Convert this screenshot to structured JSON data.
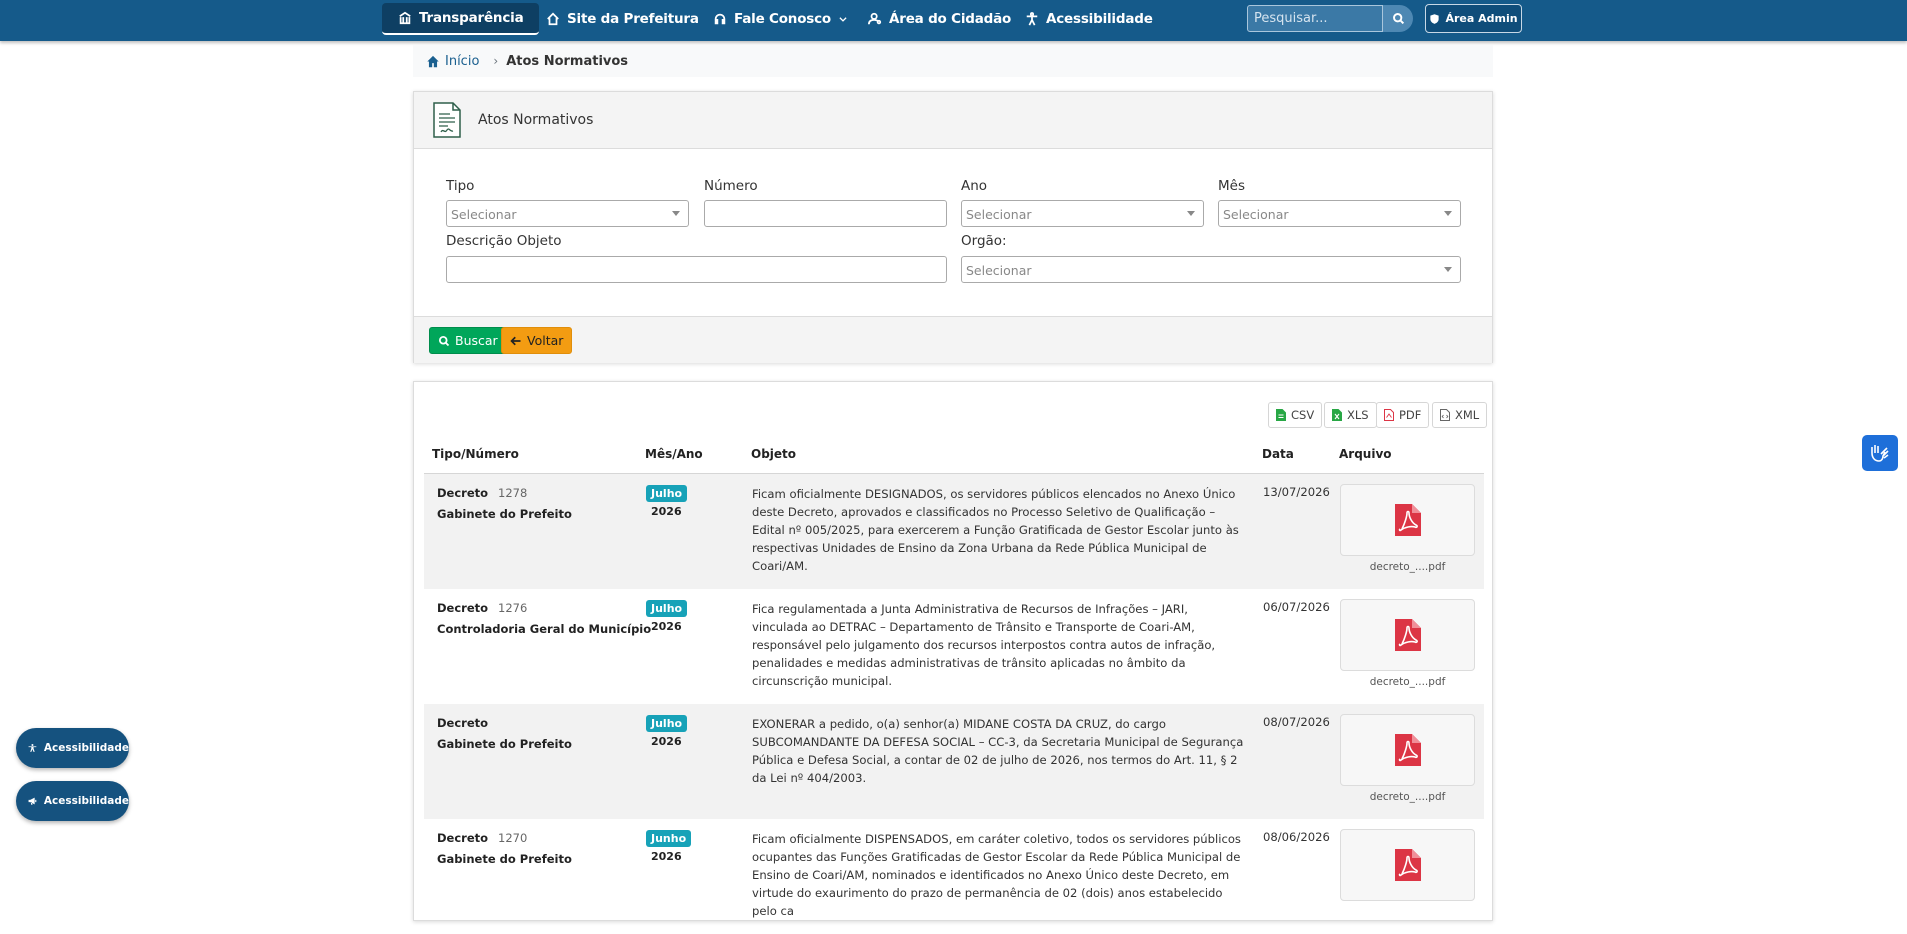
{
  "nav": {
    "transparencia": "Transparência",
    "site": "Site da Prefeitura",
    "fale": "Fale Conosco",
    "cidadao": "Área do Cidadão",
    "acessibilidade": "Acessibilidade",
    "search_placeholder": "Pesquisar...",
    "admin": "Área Admin"
  },
  "breadcrumb": {
    "home": "Início",
    "current": "Atos Normativos"
  },
  "filter": {
    "title": "Atos Normativos",
    "tipo_label": "Tipo",
    "tipo_value": "Selecionar",
    "numero_label": "Número",
    "ano_label": "Ano",
    "ano_value": "Selecionar",
    "mes_label": "Mês",
    "mes_value": "Selecionar",
    "descricao_label": "Descrição Objeto",
    "orgao_label": "Orgão:",
    "orgao_value": "Selecionar",
    "buscar": "Buscar",
    "voltar": "Voltar"
  },
  "exports": {
    "csv": "CSV",
    "xls": "XLS",
    "pdf": "PDF",
    "xml": "XML"
  },
  "table": {
    "headers": [
      "Tipo/Número",
      "Mês/Ano",
      "Objeto",
      "Data",
      "Arquivo"
    ],
    "rows": [
      {
        "tipo": "Decreto",
        "numero": "1278",
        "orgao": "Gabinete do Prefeito",
        "mes": "Julho",
        "ano": "2026",
        "objeto": "Ficam oficialmente DESIGNADOS, os servidores públicos elencados no Anexo Único deste Decreto, aprovados e classificados no Processo Seletivo de Qualificação – Edital nº 005/2025, para exercerem a Função Gratificada de Gestor Escolar junto às respectivas Unidades de Ensino da Zona Urbana da Rede Pública Municipal de Coari/AM.",
        "data": "13/07/2026",
        "arquivo": "decreto_....pdf"
      },
      {
        "tipo": "Decreto",
        "numero": "1276",
        "orgao": "Controladoria Geral do Município",
        "mes": "Julho",
        "ano": "2026",
        "objeto": "Fica regulamentada a Junta Administrativa de Recursos de Infrações – JARI, vinculada ao DETRAC – Departamento de Trânsito e Transporte de Coari-AM, responsável pelo julgamento dos recursos interpostos contra autos de infração, penalidades e medidas administrativas de trânsito aplicadas no âmbito da circunscrição municipal.",
        "data": "06/07/2026",
        "arquivo": "decreto_....pdf"
      },
      {
        "tipo": "Decreto",
        "numero": "",
        "orgao": "Gabinete do Prefeito",
        "mes": "Julho",
        "ano": "2026",
        "objeto": "EXONERAR a pedido, o(a) senhor(a) MIDANE COSTA DA CRUZ, do cargo SUBCOMANDANTE DA DEFESA SOCIAL – CC-3, da Secretaria Municipal de Segurança Pública e Defesa Social, a contar de 02 de julho de 2026, nos termos do Art. 11, § 2 da Lei nº 404/2003.",
        "data": "08/07/2026",
        "arquivo": "decreto_....pdf"
      },
      {
        "tipo": "Decreto",
        "numero": "1270",
        "orgao": "Gabinete do Prefeito",
        "mes": "Junho",
        "ano": "2026",
        "objeto": "Ficam oficialmente DISPENSADOS, em caráter coletivo, todos os servidores públicos ocupantes das Funções Gratificadas de Gestor Escolar da Rede Pública Municipal de Ensino de Coari/AM, nominados e identificados no Anexo Único deste Decreto, em virtude do exaurimento do prazo de permanência de 02 (dois) anos estabelecido pelo ca",
        "data": "08/06/2026",
        "arquivo": ""
      }
    ]
  },
  "floating": {
    "acc1": "Acessibilidade",
    "acc2": "Acessibilidade"
  }
}
